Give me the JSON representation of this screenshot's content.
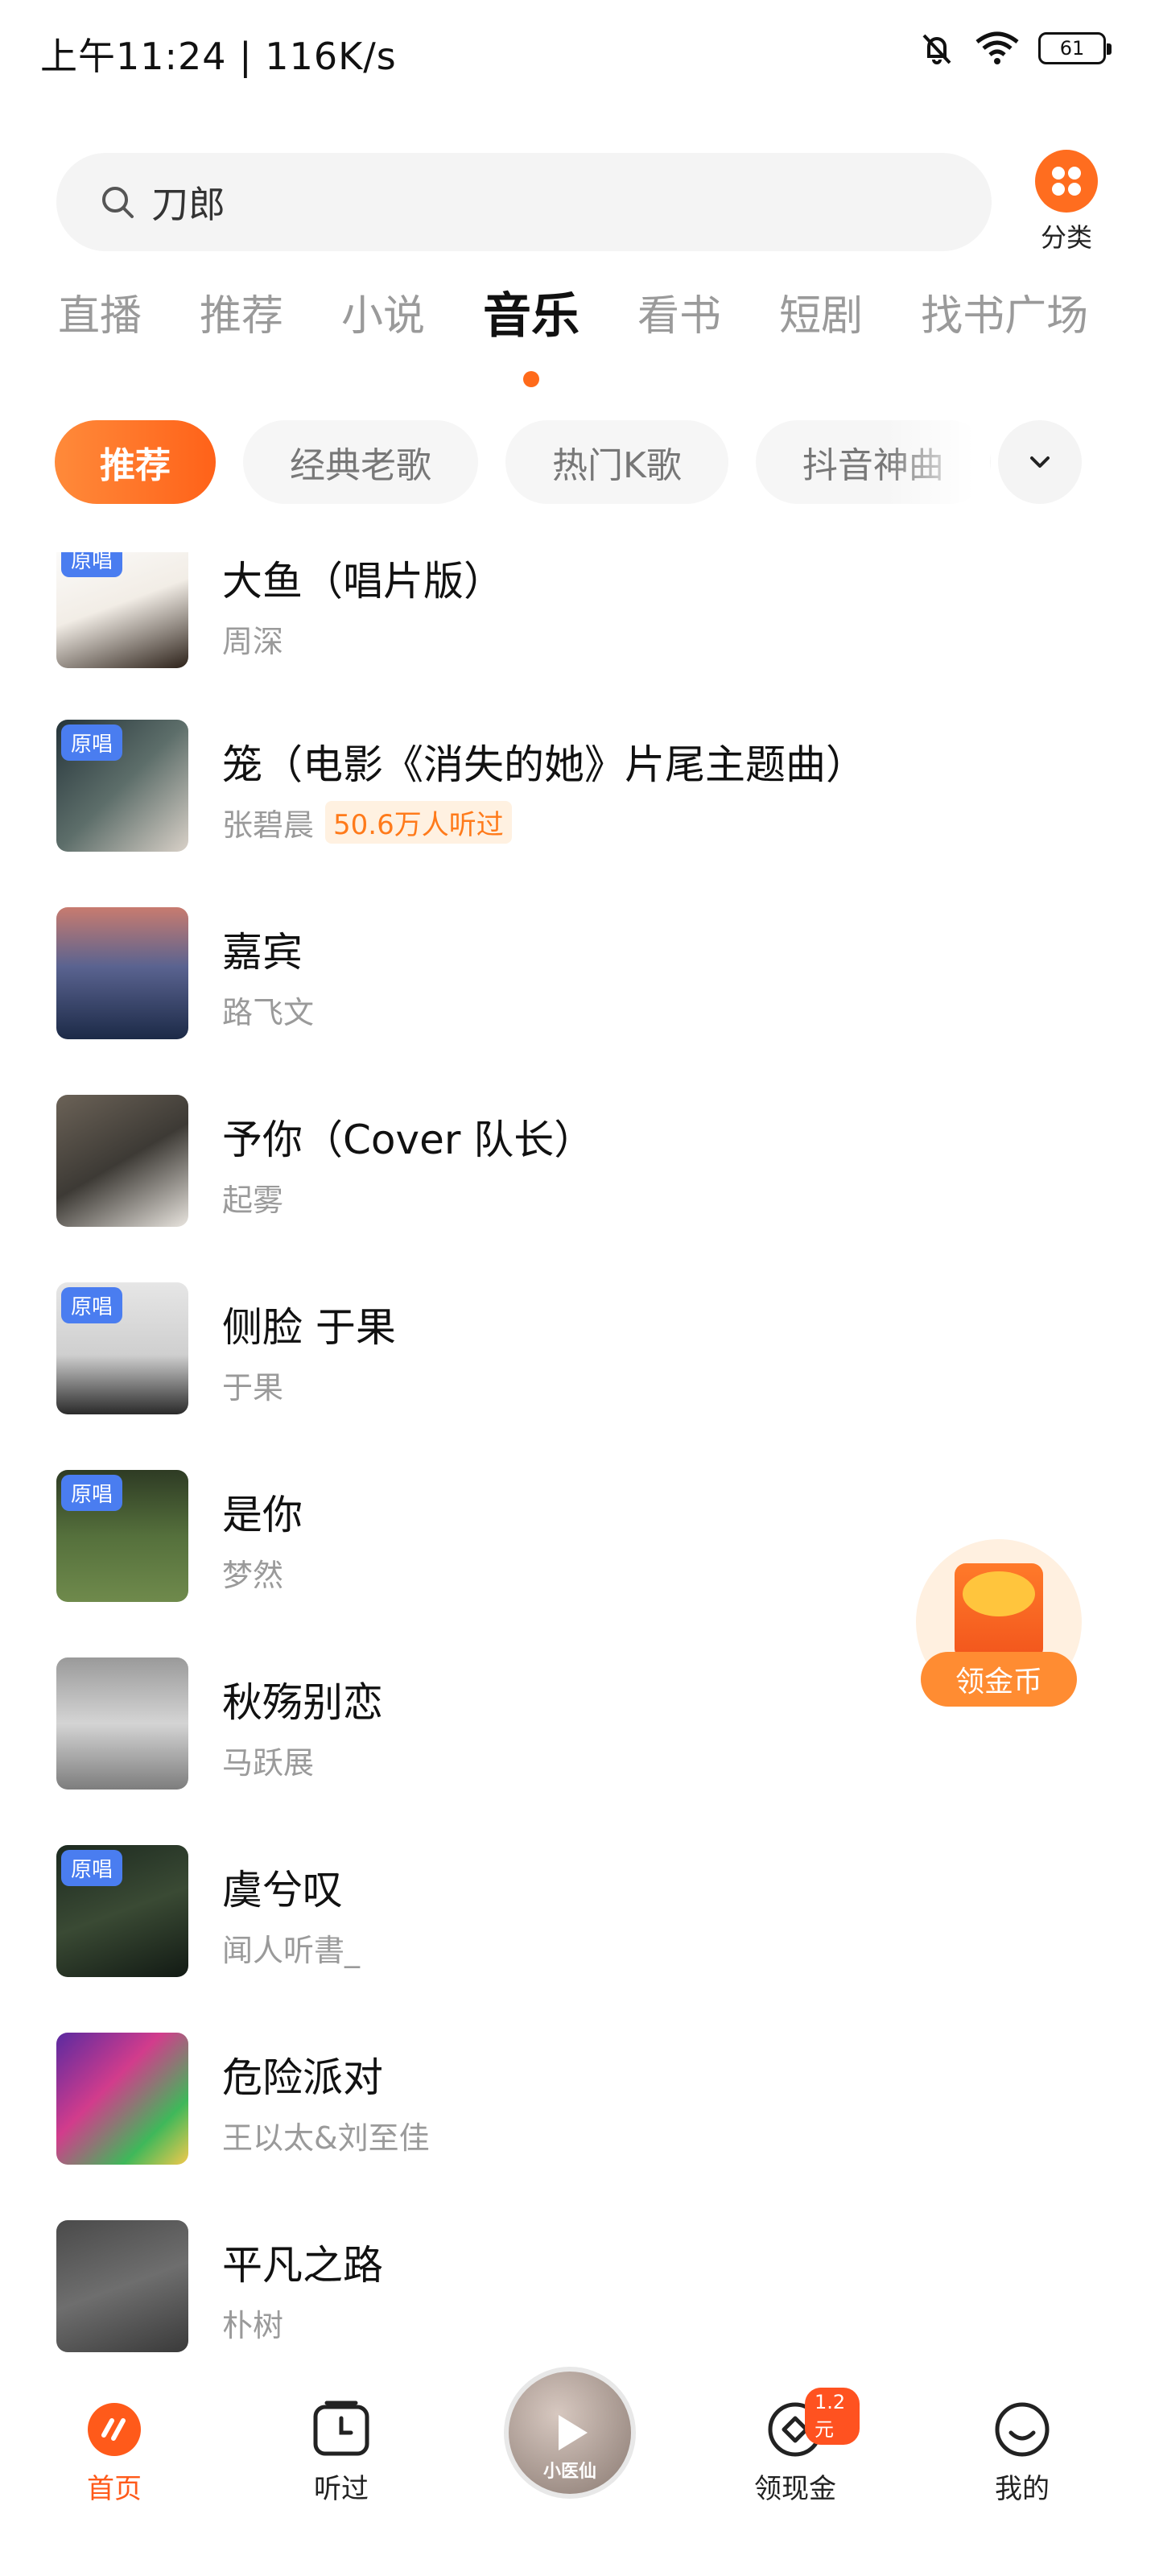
{
  "status_bar": {
    "time": "上午11:24 | 116K/s",
    "battery": "61"
  },
  "search": {
    "query": "刀郎",
    "category_label": "分类"
  },
  "tabs": [
    {
      "label": "直播"
    },
    {
      "label": "推荐"
    },
    {
      "label": "小说"
    },
    {
      "label": "音乐",
      "active": true
    },
    {
      "label": "看书"
    },
    {
      "label": "短剧"
    },
    {
      "label": "找书广场"
    }
  ],
  "chips": [
    {
      "label": "推荐",
      "active": true
    },
    {
      "label": "经典老歌"
    },
    {
      "label": "热门K歌"
    },
    {
      "label": "抖音神曲"
    }
  ],
  "songs": [
    {
      "title": "大鱼（唱片版）",
      "artist": "周深",
      "original_badge": "原唱"
    },
    {
      "title": "笼（电影《消失的她》片尾主题曲）",
      "artist": "张碧晨",
      "original_badge": "原唱",
      "listen_count": "50.6万人听过"
    },
    {
      "title": "嘉宾",
      "artist": "路飞文"
    },
    {
      "title": "予你（Cover 队长）",
      "artist": "起雾"
    },
    {
      "title": "侧脸 于果",
      "artist": "于果",
      "original_badge": "原唱"
    },
    {
      "title": "是你",
      "artist": "梦然",
      "original_badge": "原唱"
    },
    {
      "title": "秋殇别恋",
      "artist": "马跃展"
    },
    {
      "title": "虞兮叹",
      "artist": "闻人听書_",
      "original_badge": "原唱"
    },
    {
      "title": "危险派对",
      "artist": "王以太&刘至佳"
    },
    {
      "title": "平凡之路",
      "artist": "朴树"
    }
  ],
  "floating": {
    "coin_label": "领金币"
  },
  "bottom_nav": {
    "home": "首页",
    "history": "听过",
    "player_caption": "小医仙",
    "cash": "领现金",
    "cash_badge": "1.2元",
    "me": "我的"
  },
  "colors": {
    "accent": "#ff6a1a",
    "badge_blue": "#4a7df0"
  }
}
